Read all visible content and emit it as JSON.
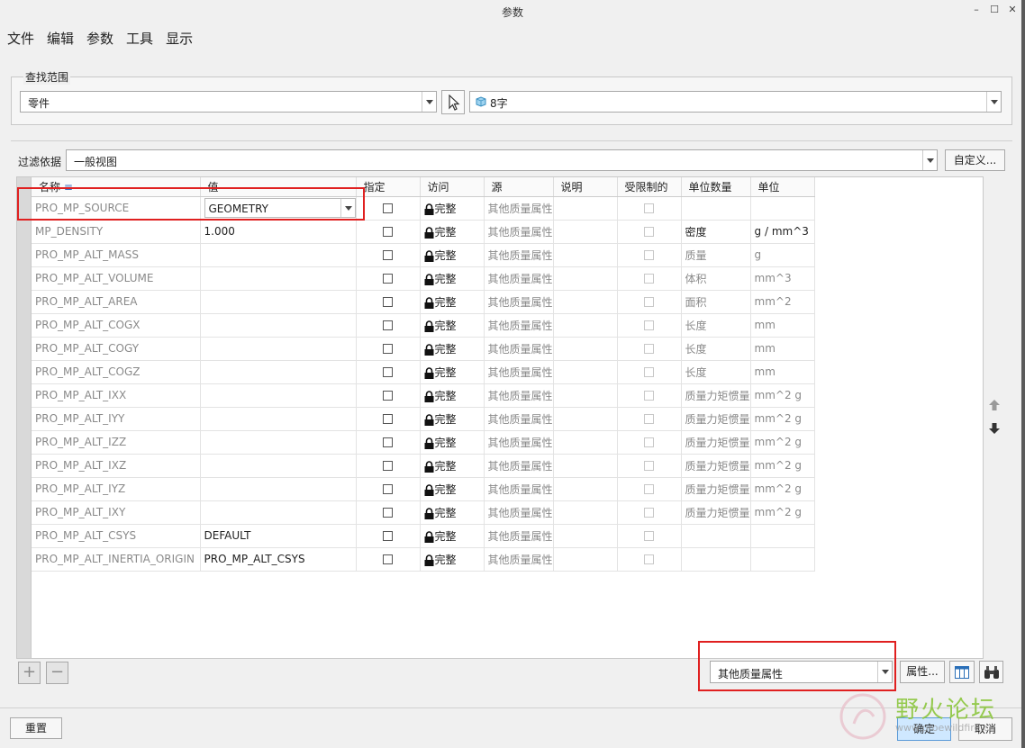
{
  "window": {
    "title": "参数",
    "min": "–",
    "max": "☐",
    "close": "✕"
  },
  "menu": [
    "文件",
    "编辑",
    "参数",
    "工具",
    "显示"
  ],
  "scope": {
    "legend": "查找范围",
    "type_value": "零件",
    "model_value": "8字"
  },
  "filter": {
    "label": "过滤依据",
    "value": "一般视图",
    "customize_button": "自定义..."
  },
  "table": {
    "headers": [
      "名称",
      "值",
      "指定",
      "访问",
      "源",
      "说明",
      "受限制的",
      "单位数量",
      "单位"
    ],
    "rows": [
      {
        "name": "PRO_MP_SOURCE",
        "value": "GEOMETRY",
        "access": "完整",
        "source": "其他质量属性",
        "unit_qty": "",
        "unit": ""
      },
      {
        "name": "MP_DENSITY",
        "value": "1.000",
        "access": "完整",
        "source": "其他质量属性",
        "unit_qty": "密度",
        "unit": "g / mm^3"
      },
      {
        "name": "PRO_MP_ALT_MASS",
        "value": "",
        "access": "完整",
        "source": "其他质量属性",
        "unit_qty": "质量",
        "unit": "g"
      },
      {
        "name": "PRO_MP_ALT_VOLUME",
        "value": "",
        "access": "完整",
        "source": "其他质量属性",
        "unit_qty": "体积",
        "unit": "mm^3"
      },
      {
        "name": "PRO_MP_ALT_AREA",
        "value": "",
        "access": "完整",
        "source": "其他质量属性",
        "unit_qty": "面积",
        "unit": "mm^2"
      },
      {
        "name": "PRO_MP_ALT_COGX",
        "value": "",
        "access": "完整",
        "source": "其他质量属性",
        "unit_qty": "长度",
        "unit": "mm"
      },
      {
        "name": "PRO_MP_ALT_COGY",
        "value": "",
        "access": "完整",
        "source": "其他质量属性",
        "unit_qty": "长度",
        "unit": "mm"
      },
      {
        "name": "PRO_MP_ALT_COGZ",
        "value": "",
        "access": "完整",
        "source": "其他质量属性",
        "unit_qty": "长度",
        "unit": "mm"
      },
      {
        "name": "PRO_MP_ALT_IXX",
        "value": "",
        "access": "完整",
        "source": "其他质量属性",
        "unit_qty": "质量力矩惯量",
        "unit": "mm^2 g"
      },
      {
        "name": "PRO_MP_ALT_IYY",
        "value": "",
        "access": "完整",
        "source": "其他质量属性",
        "unit_qty": "质量力矩惯量",
        "unit": "mm^2 g"
      },
      {
        "name": "PRO_MP_ALT_IZZ",
        "value": "",
        "access": "完整",
        "source": "其他质量属性",
        "unit_qty": "质量力矩惯量",
        "unit": "mm^2 g"
      },
      {
        "name": "PRO_MP_ALT_IXZ",
        "value": "",
        "access": "完整",
        "source": "其他质量属性",
        "unit_qty": "质量力矩惯量",
        "unit": "mm^2 g"
      },
      {
        "name": "PRO_MP_ALT_IYZ",
        "value": "",
        "access": "完整",
        "source": "其他质量属性",
        "unit_qty": "质量力矩惯量",
        "unit": "mm^2 g"
      },
      {
        "name": "PRO_MP_ALT_IXY",
        "value": "",
        "access": "完整",
        "source": "其他质量属性",
        "unit_qty": "质量力矩惯量",
        "unit": "mm^2 g"
      },
      {
        "name": "PRO_MP_ALT_CSYS",
        "value": "DEFAULT",
        "access": "完整",
        "source": "其他质量属性",
        "unit_qty": "",
        "unit": ""
      },
      {
        "name": "PRO_MP_ALT_INERTIA_ORIGIN",
        "value": "PRO_MP_ALT_CSYS",
        "access": "完整",
        "source": "其他质量属性",
        "unit_qty": "",
        "unit": ""
      }
    ]
  },
  "bottom": {
    "add": "+",
    "remove": "−",
    "source_select": "其他质量属性",
    "properties_button": "属性...",
    "reset_button": "重置",
    "ok_button": "确定",
    "cancel_button": "取消"
  },
  "watermark": {
    "text": "野火论坛",
    "url_text": "www.proewildfire.cn"
  },
  "colors": {
    "highlight": "#e02020",
    "ok_button": "#cfe8ff"
  }
}
